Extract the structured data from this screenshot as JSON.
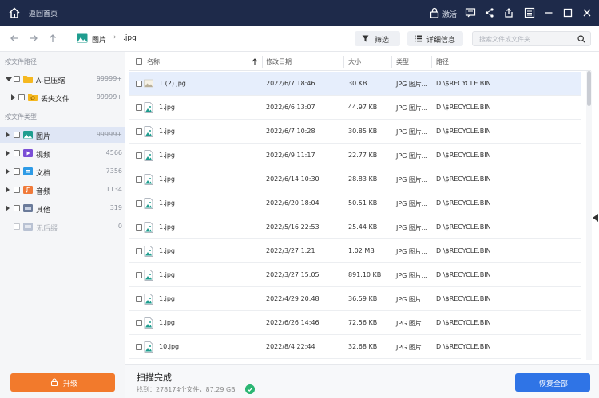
{
  "titlebar": {
    "back_home": "返回首页",
    "activate": "激活",
    "icons": [
      "home-icon",
      "lock-icon",
      "message-icon",
      "share-icon",
      "export-icon",
      "menu-icon",
      "minimize-icon",
      "maximize-icon",
      "close-icon"
    ]
  },
  "nav": {
    "breadcrumb": [
      "图片",
      ".jpg"
    ],
    "filter_label": "筛选",
    "details_label": "详细信息",
    "search_placeholder": "搜索文件或文件夹"
  },
  "sidebar": {
    "by_path_title": "按文件路径",
    "path_items": [
      {
        "label": "A-已压缩",
        "count": "99999+"
      },
      {
        "label": "丢失文件",
        "count": "99999+"
      }
    ],
    "by_type_title": "按文件类型",
    "type_items": [
      {
        "label": "图片",
        "count": "99999+"
      },
      {
        "label": "视频",
        "count": "4566"
      },
      {
        "label": "文档",
        "count": "7356"
      },
      {
        "label": "音频",
        "count": "1134"
      },
      {
        "label": "其他",
        "count": "319"
      },
      {
        "label": "无后缀",
        "count": "0"
      }
    ],
    "upgrade_label": "升级"
  },
  "table": {
    "headers": {
      "name": "名称",
      "date": "修改日期",
      "size": "大小",
      "type": "类型",
      "path": "路径"
    },
    "rows": [
      {
        "name": "1 (2).jpg",
        "date": "2022/6/7 18:46",
        "size": "30 KB",
        "type": "JPG 图片...",
        "path": "D:\\$RECYCLE.BIN"
      },
      {
        "name": "1.jpg",
        "date": "2022/6/6 13:07",
        "size": "44.97 KB",
        "type": "JPG 图片...",
        "path": "D:\\$RECYCLE.BIN"
      },
      {
        "name": "1.jpg",
        "date": "2022/6/7 10:28",
        "size": "30.85 KB",
        "type": "JPG 图片...",
        "path": "D:\\$RECYCLE.BIN"
      },
      {
        "name": "1.jpg",
        "date": "2022/6/9 11:17",
        "size": "22.77 KB",
        "type": "JPG 图片...",
        "path": "D:\\$RECYCLE.BIN"
      },
      {
        "name": "1.jpg",
        "date": "2022/6/14 10:30",
        "size": "28.83 KB",
        "type": "JPG 图片...",
        "path": "D:\\$RECYCLE.BIN"
      },
      {
        "name": "1.jpg",
        "date": "2022/6/20 18:04",
        "size": "50.51 KB",
        "type": "JPG 图片...",
        "path": "D:\\$RECYCLE.BIN"
      },
      {
        "name": "1.jpg",
        "date": "2022/5/16 22:53",
        "size": "25.44 KB",
        "type": "JPG 图片...",
        "path": "D:\\$RECYCLE.BIN"
      },
      {
        "name": "1.jpg",
        "date": "2022/3/27 1:21",
        "size": "1.02 MB",
        "type": "JPG 图片...",
        "path": "D:\\$RECYCLE.BIN"
      },
      {
        "name": "1.jpg",
        "date": "2022/3/27 15:05",
        "size": "891.10 KB",
        "type": "JPG 图片...",
        "path": "D:\\$RECYCLE.BIN"
      },
      {
        "name": "1.jpg",
        "date": "2022/4/29 20:48",
        "size": "36.59 KB",
        "type": "JPG 图片...",
        "path": "D:\\$RECYCLE.BIN"
      },
      {
        "name": "1.jpg",
        "date": "2022/6/26 14:46",
        "size": "72.56 KB",
        "type": "JPG 图片...",
        "path": "D:\\$RECYCLE.BIN"
      },
      {
        "name": "10.jpg",
        "date": "2022/8/4 22:44",
        "size": "32.68 KB",
        "type": "JPG 图片...",
        "path": "D:\\$RECYCLE.BIN"
      }
    ]
  },
  "footer": {
    "status": "扫描完成",
    "summary": "找到：278174个文件，87.29 GB",
    "recover_all_label": "恢复全部"
  },
  "colors": {
    "titlebar": "#1e2a4a",
    "accent_blue": "#2f74e6",
    "upgrade_orange": "#f27a2c",
    "success_green": "#2bb673"
  }
}
